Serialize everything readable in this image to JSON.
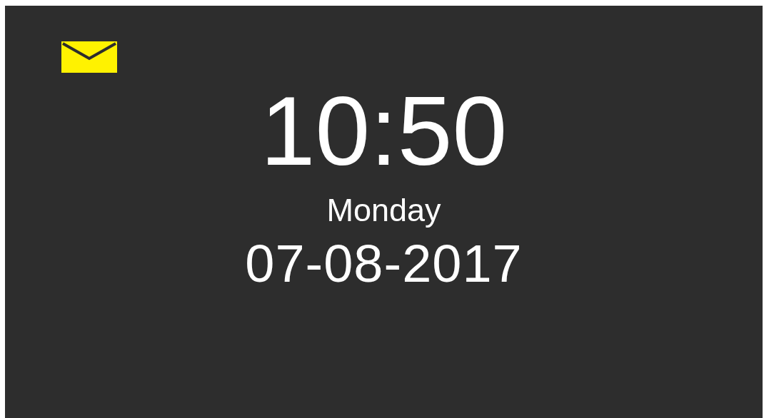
{
  "clock": {
    "time": "10:50",
    "day": "Monday",
    "date": "07-08-2017"
  }
}
